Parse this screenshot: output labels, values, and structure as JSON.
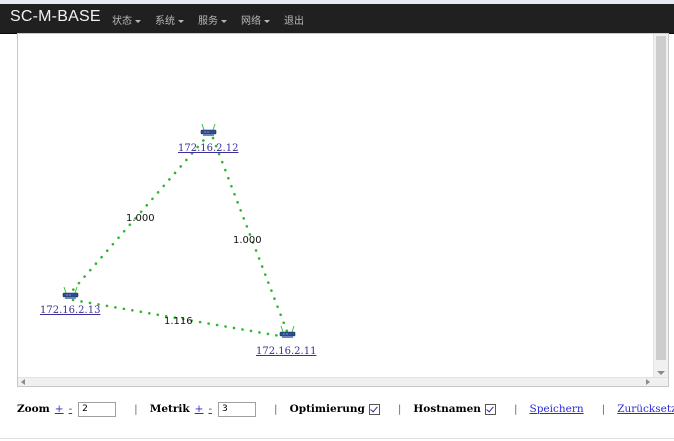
{
  "brand": "SC-M-BASE",
  "nav": [
    {
      "label": "状态"
    },
    {
      "label": "系统"
    },
    {
      "label": "服务"
    },
    {
      "label": "网络"
    },
    {
      "label": "退出"
    }
  ],
  "graph": {
    "link_color": "#2db82d",
    "label_color": "#3a2f9a",
    "nodes": [
      {
        "id": "n12",
        "label": "172.16.2.12"
      },
      {
        "id": "n13",
        "label": "172.16.2.13"
      },
      {
        "id": "n11",
        "label": "172.16.2.11"
      }
    ],
    "links": [
      {
        "id": "l1213",
        "metric": "1.000"
      },
      {
        "id": "l1211",
        "metric": "1.000"
      },
      {
        "id": "l1311",
        "metric": "1.116"
      }
    ]
  },
  "controls": {
    "zoom_label": "Zoom",
    "zoom_plus": "+",
    "zoom_minus": "-",
    "zoom_value": "2",
    "metrik_label": "Metrik",
    "metrik_plus": "+",
    "metrik_minus": "-",
    "metrik_value": "3",
    "sep": "|",
    "opt_label": "Optimierung",
    "host_label": "Hostnamen",
    "save_label": "Speichern",
    "reset_label": "Zurücksetzen"
  }
}
